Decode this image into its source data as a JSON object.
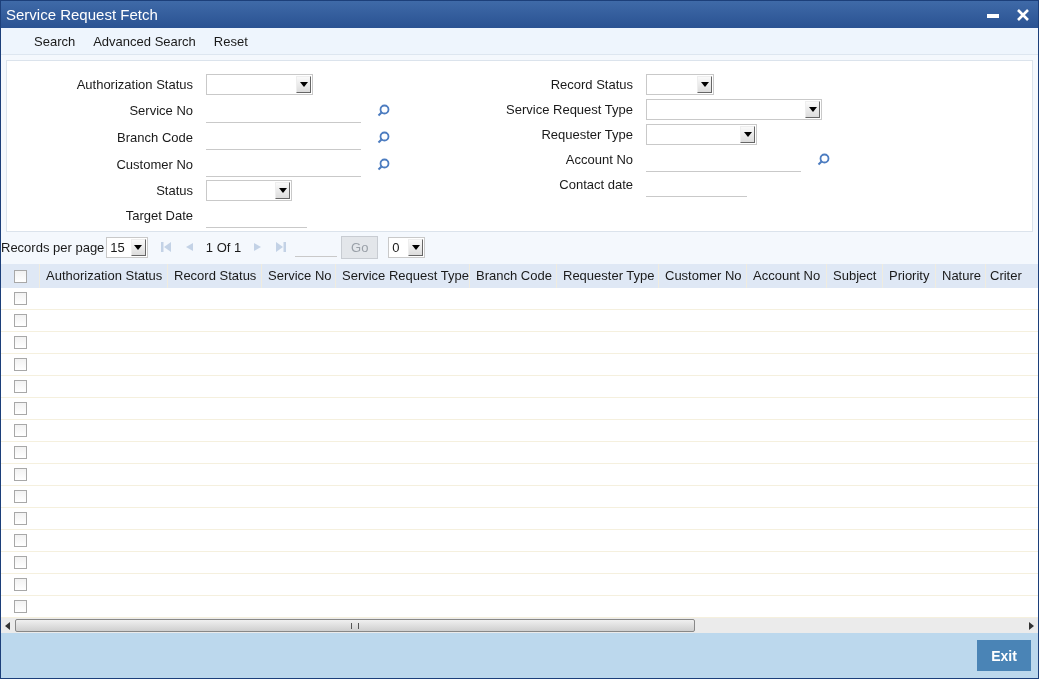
{
  "window": {
    "title": "Service Request Fetch"
  },
  "toolbar": [
    "Search",
    "Advanced Search",
    "Reset"
  ],
  "form": {
    "left": [
      {
        "label": "Authorization Status",
        "kind": "select"
      },
      {
        "label": "Service No",
        "kind": "lookup"
      },
      {
        "label": "Branch Code",
        "kind": "lookup"
      },
      {
        "label": "Customer No",
        "kind": "lookup"
      },
      {
        "label": "Status",
        "kind": "select"
      },
      {
        "label": "Target Date",
        "kind": "date"
      }
    ],
    "right": [
      {
        "label": "Record Status",
        "kind": "select"
      },
      {
        "label": "Service Request Type",
        "kind": "select"
      },
      {
        "label": "Requester Type",
        "kind": "select"
      },
      {
        "label": "Account No",
        "kind": "lookup"
      },
      {
        "label": "Contact date",
        "kind": "date"
      }
    ]
  },
  "pager": {
    "label": "Records per page",
    "per_page": "15",
    "page_text": "1 Of 1",
    "go": {
      "label": "Go",
      "disabled": true
    },
    "page_select": "0"
  },
  "table": {
    "select_all_checked": false,
    "columns": [
      "Authorization Status",
      "Record Status",
      "Service No",
      "Service Request Type",
      "Branch Code",
      "Requester Type",
      "Customer No",
      "Account No",
      "Subject",
      "Priority",
      "Nature",
      "Criter"
    ],
    "rows": [
      {
        "checked": false
      },
      {
        "checked": false
      },
      {
        "checked": false
      },
      {
        "checked": false
      },
      {
        "checked": false
      },
      {
        "checked": false
      },
      {
        "checked": false
      },
      {
        "checked": false
      },
      {
        "checked": false
      },
      {
        "checked": false
      },
      {
        "checked": false
      },
      {
        "checked": false
      },
      {
        "checked": false
      },
      {
        "checked": false
      },
      {
        "checked": false
      }
    ]
  },
  "footer": {
    "button": "Exit"
  }
}
